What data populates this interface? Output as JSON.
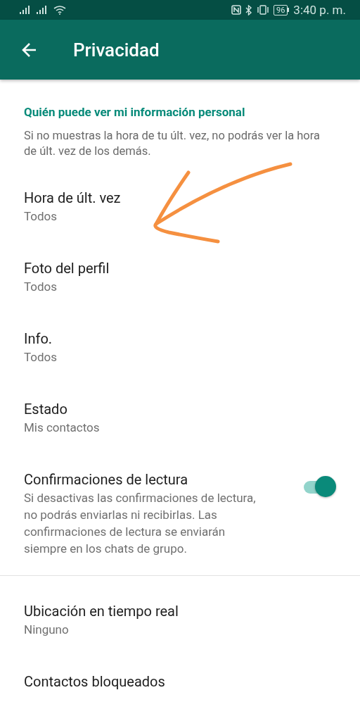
{
  "status_bar": {
    "battery": "96",
    "time": "3:40 p. m."
  },
  "app_bar": {
    "title": "Privacidad"
  },
  "groups": [
    {
      "header": "Quién puede ver mi información personal",
      "description": "Si no muestras la hora de tu últ. vez, no podrás ver la hora de últ. vez de los demás.",
      "items": [
        {
          "kind": "choice",
          "title": "Hora de últ. vez",
          "summary": "Todos"
        },
        {
          "kind": "choice",
          "title": "Foto del perfil",
          "summary": "Todos"
        },
        {
          "kind": "choice",
          "title": "Info.",
          "summary": "Todos"
        },
        {
          "kind": "choice",
          "title": "Estado",
          "summary": "Mis contactos"
        },
        {
          "kind": "switch",
          "title": "Confirmaciones de lectura",
          "summary": "Si desactivas las confirmaciones de lectura, no podrás enviarlas ni recibirlas. Las confirmaciones de lectura se enviarán siempre en los chats de grupo.",
          "on": true
        }
      ]
    },
    {
      "items": [
        {
          "kind": "choice",
          "title": "Ubicación en tiempo real",
          "summary": "Ninguno"
        },
        {
          "kind": "choice",
          "title": "Contactos bloqueados"
        }
      ]
    }
  ]
}
